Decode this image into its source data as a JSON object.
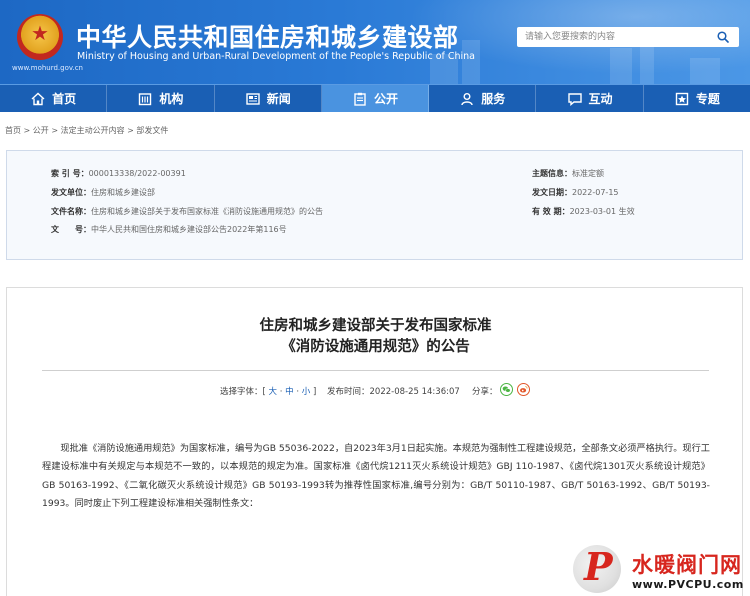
{
  "header": {
    "ministry_cn": "中华人民共和国住房和城乡建设部",
    "ministry_en": "Ministry of Housing and Urban-Rural Development of the People's Republic of China",
    "domain": "www.mohurd.gov.cn",
    "search_placeholder": "请输入您要搜索的内容"
  },
  "nav": {
    "items": [
      {
        "label": "首页",
        "icon": "home-icon"
      },
      {
        "label": "机构",
        "icon": "building-icon"
      },
      {
        "label": "新闻",
        "icon": "newspaper-icon"
      },
      {
        "label": "公开",
        "icon": "clipboard-icon",
        "active": true
      },
      {
        "label": "服务",
        "icon": "people-icon"
      },
      {
        "label": "互动",
        "icon": "chat-icon"
      },
      {
        "label": "专题",
        "icon": "bookmark-icon"
      }
    ]
  },
  "breadcrumb": {
    "home": "首页",
    "sep": " > ",
    "l1": "公开",
    "l2": "法定主动公开内容",
    "l3": "部发文件"
  },
  "info": {
    "index_label": "索 引 号：",
    "index_value": "000013338/2022-00391",
    "unit_label": "发文单位：",
    "unit_value": "住房和城乡建设部",
    "name_label": "文件名称：",
    "name_value": "住房和城乡建设部关于发布国家标准《消防设施通用规范》的公告",
    "docno_label": "文　　号：",
    "docno_value": "中华人民共和国住房和城乡建设部公告2022年第116号",
    "topic_label": "主题信息：",
    "topic_value": "标准定额",
    "date_label": "发文日期：",
    "date_value": "2022-07-15",
    "validity_label": "有 效 期：",
    "validity_value": "2023-03-01 生效"
  },
  "article": {
    "title_line1": "住房和城乡建设部关于发布国家标准",
    "title_line2": "《消防设施通用规范》的公告",
    "font_size_label": "选择字体：",
    "font_size_open": "[ ",
    "font_large": "大",
    "font_medium": "中",
    "font_small": "小",
    "font_size_close": " ]",
    "font_sep": " · ",
    "publish_label": "发布时间：",
    "publish_value": "2022-08-25 14:36:07",
    "share_label": "分享：",
    "body": "现批准《消防设施通用规范》为国家标准，编号为GB 55036-2022，自2023年3月1日起实施。本规范为强制性工程建设规范，全部条文必须严格执行。现行工程建设标准中有关规定与本规范不一致的，以本规范的规定为准。国家标准《卤代烷1211灭火系统设计规范》GBJ 110-1987、《卤代烷1301灭火系统设计规范》GB 50163-1992、《二氧化碳灭火系统设计规范》GB 50193-1993转为推荐性国家标准,编号分别为：GB/T 50110-1987、GB/T 50163-1992、GB/T 50193-1993。同时废止下列工程建设标准相关强制性条文："
  },
  "watermark": {
    "logo_letter": "P",
    "name_cn": "水暖阀门网",
    "url": "www.PVCPU.com"
  },
  "colors": {
    "header_blue": "#1d68c4",
    "nav_blue": "#1a5fb4",
    "nav_active": "#4a93e0",
    "watermark_red": "#d7261e"
  }
}
